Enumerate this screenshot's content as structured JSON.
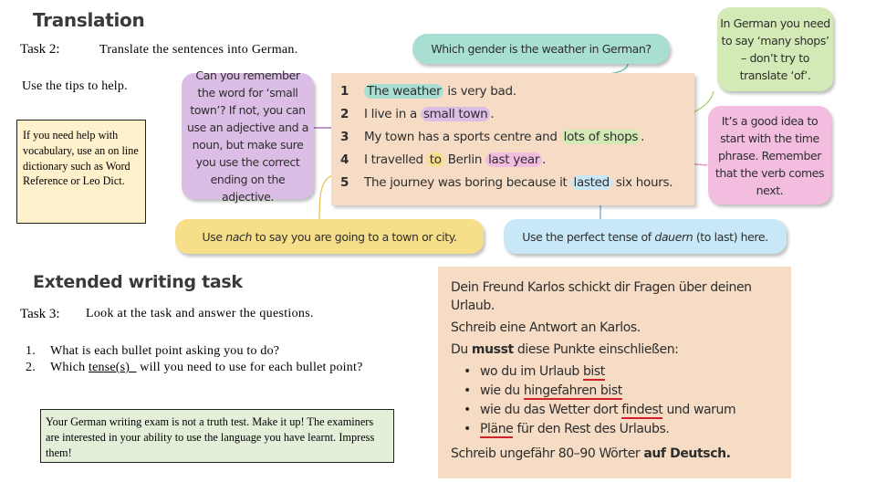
{
  "translation": {
    "heading": "Translation",
    "task_label": "Task 2:",
    "task_text": "Translate the sentences into German.",
    "tips_text": "Use the tips to help.",
    "help_box": "If you need help with vocabulary, use an on line dictionary such as Word Reference or Leo Dict.",
    "tips": {
      "small_town": "Can you remember the word for ‘small town’? If not, you can use an adjective and a noun, but make sure you use the correct ending on the adjective.",
      "gender": "Which gender is the weather in German?",
      "many_shops": "In German you need to say ‘many shops’ – don’t try to translate ‘of’.",
      "time_phrase": "It’s a good idea to start with the time phrase. Remember that the verb comes next.",
      "nach_pre": "Use ",
      "nach_em": "nach",
      "nach_post": " to say you are going to a town or city.",
      "dauern_pre": "Use the perfect tense of ",
      "dauern_em": "dauern",
      "dauern_post": " (to last) here."
    },
    "sentences": [
      {
        "num": "1",
        "parts": [
          "",
          "The weather",
          " is very bad."
        ]
      },
      {
        "num": "2",
        "parts": [
          "I live in a ",
          "small town",
          "."
        ]
      },
      {
        "num": "3",
        "parts": [
          "My town has a sports centre and ",
          "lots of shops",
          "."
        ]
      },
      {
        "num": "4",
        "parts": [
          "I travelled ",
          "to",
          " Berlin ",
          "last year",
          "."
        ]
      },
      {
        "num": "5",
        "parts": [
          "The journey was boring because it ",
          "lasted",
          " six hours."
        ]
      }
    ],
    "colors": {
      "teal": "#a9dfd3",
      "purple": "#dcbde6",
      "green": "#d3eab6",
      "yellow": "#f7df8a",
      "pink": "#f3bde0",
      "blue": "#c9e8f7",
      "panel": "#f6dcc4"
    }
  },
  "extended": {
    "heading": "Extended writing task",
    "task_label": "Task 3:",
    "task_text": "Look at the task and answer the questions.",
    "questions": [
      {
        "num": "1.",
        "text": "What is each bullet point asking you to do?"
      },
      {
        "num": "2.",
        "pre": "Which ",
        "underline": "tense(s)  ",
        "post": " will you need to use for each bullet point?"
      }
    ],
    "note_box": "Your German writing exam is not a truth test.  Make it up! The examiners are interested in your ability to use the language you have learnt.  Impress them!",
    "german_task": {
      "intro": "Dein Freund Karlos schickt dir Fragen über deinen Urlaub.",
      "instruction": "Schreib eine Antwort an Karlos.",
      "must_pre": "Du ",
      "must_bold": "musst",
      "must_post": " diese Punkte einschließen:",
      "bullets": [
        {
          "pre": "wo du im Urlaub ",
          "ul": "bist",
          "post": ""
        },
        {
          "pre": "wie du ",
          "ul": "hingefahren bist",
          "post": ""
        },
        {
          "pre": "wie du das Wetter dort ",
          "ul": "findest",
          "post": " und warum"
        },
        {
          "pre": "",
          "ul": "Pläne",
          "post": " für den Rest des Urlaubs."
        }
      ],
      "words_pre": "Schreib ungefähr 80–90 Wörter ",
      "words_bold": "auf Deutsch."
    }
  }
}
